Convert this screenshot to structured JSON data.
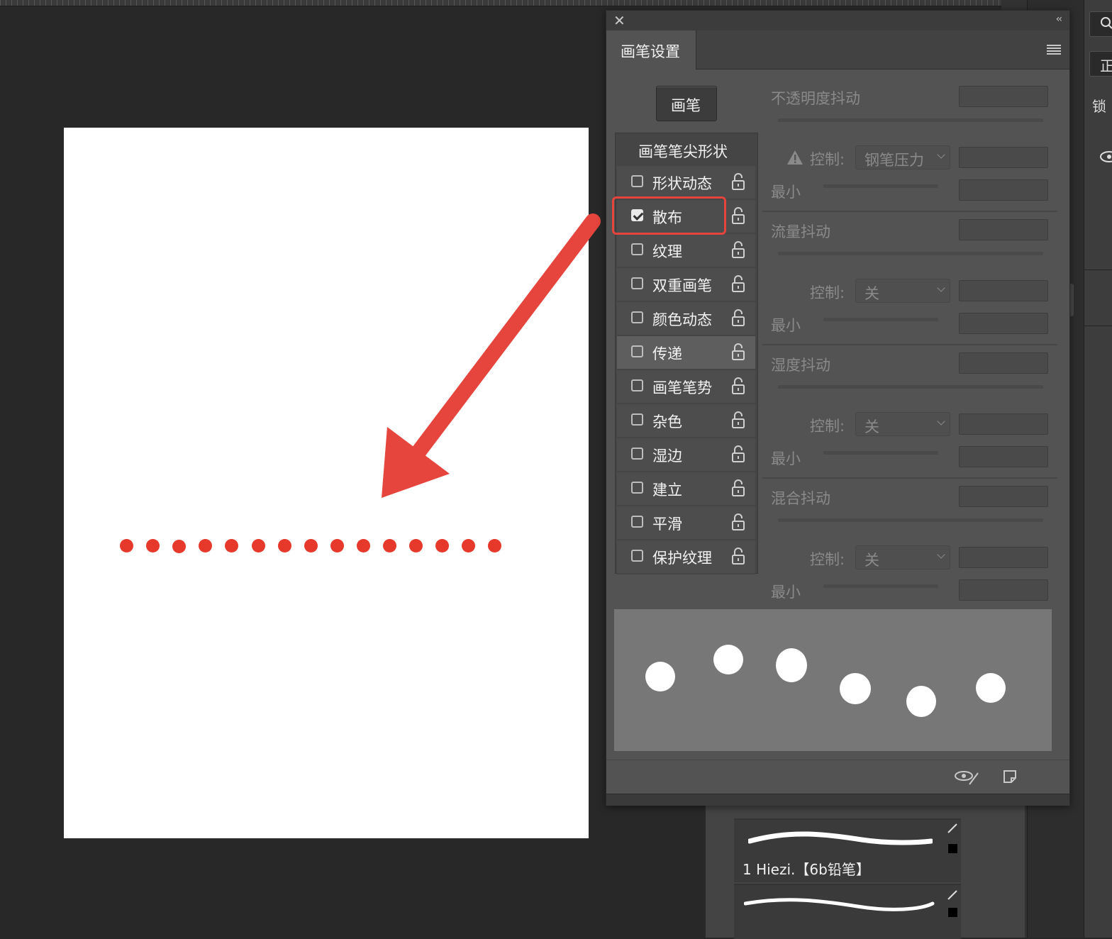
{
  "panel": {
    "tab_title": "画笔设置",
    "brushes_button": "画笔",
    "brush_tip_shape": "画笔笔尖形状",
    "options": [
      {
        "label": "形状动态",
        "checked": false
      },
      {
        "label": "散布",
        "checked": true
      },
      {
        "label": "纹理",
        "checked": false
      },
      {
        "label": "双重画笔",
        "checked": false
      },
      {
        "label": "颜色动态",
        "checked": false
      },
      {
        "label": "传递",
        "checked": false,
        "selected": true
      },
      {
        "label": "画笔笔势",
        "checked": false
      },
      {
        "label": "杂色",
        "checked": false
      },
      {
        "label": "湿边",
        "checked": false
      },
      {
        "label": "建立",
        "checked": false
      },
      {
        "label": "平滑",
        "checked": false
      },
      {
        "label": "保护纹理",
        "checked": false
      }
    ],
    "transfer": {
      "opacity_jitter": "不透明度抖动",
      "control_label": "控制:",
      "control_pen": "钢笔压力",
      "minimum": "最小",
      "flow_jitter": "流量抖动",
      "control_off": "关",
      "wetness_jitter": "湿度抖动",
      "mix_jitter": "混合抖动"
    }
  },
  "brushes_list": {
    "item_name": "1 Hiezi.【6b铅笔】"
  },
  "dock": {
    "lock_label": "锁",
    "mode_glyph": "正"
  },
  "colors": {
    "accent_red": "#e5453d",
    "stroke_red": "#e6392b"
  },
  "icons": [
    "close-icon",
    "collapse-icon",
    "panel-menu-icon",
    "lock-icon",
    "warning-icon",
    "eye-brush-icon",
    "new-preset-icon",
    "brush-icon",
    "eye-icon",
    "search-icon"
  ]
}
